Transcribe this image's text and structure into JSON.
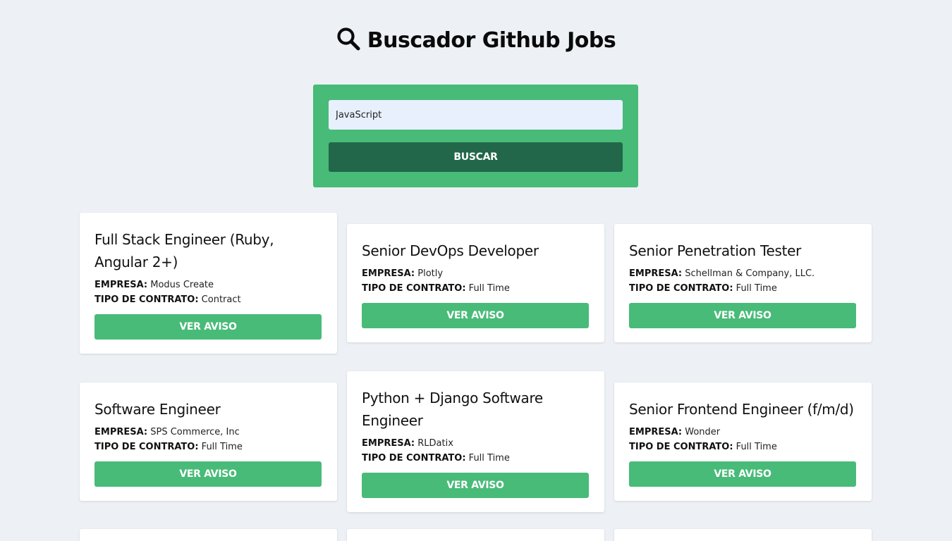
{
  "header": {
    "title": "Buscador Github Jobs",
    "icon": "search-icon"
  },
  "search": {
    "value": "JavaScript",
    "button_label": "Buscar"
  },
  "labels": {
    "company": "EMPRESA:",
    "contract": "TIPO DE CONTRATO:",
    "view_button": "Ver aviso"
  },
  "jobs": [
    {
      "title": "Full Stack Engineer (Ruby, Angular 2+)",
      "company": "Modus Create",
      "contract": "Contract"
    },
    {
      "title": "Senior DevOps Developer",
      "company": "Plotly",
      "contract": "Full Time"
    },
    {
      "title": "Senior Penetration Tester",
      "company": "Schellman & Company, LLC.",
      "contract": "Full Time"
    },
    {
      "title": "Software Engineer",
      "company": "SPS Commerce, Inc",
      "contract": "Full Time"
    },
    {
      "title": "Python + Django Software Engineer",
      "company": "RLDatix",
      "contract": "Full Time"
    },
    {
      "title": "Senior Frontend Engineer (f/m/d)",
      "company": "Wonder",
      "contract": "Full Time"
    }
  ],
  "colors": {
    "background": "#edf1f5",
    "accent": "#48bb78",
    "accent_dark": "#22674a",
    "input_bg": "#e8f0fe"
  }
}
